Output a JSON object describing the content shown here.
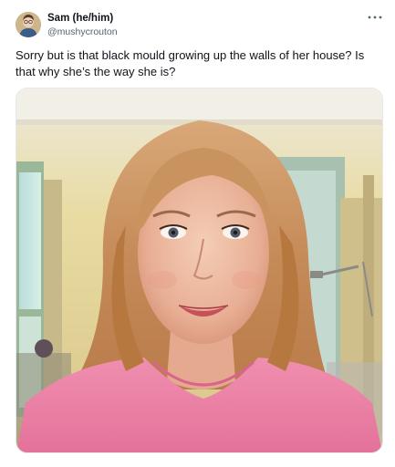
{
  "tweet": {
    "author": {
      "display_name": "Sam (he/him)",
      "handle": "@mushycrouton",
      "avatar_icon": "profile-photo-avatar"
    },
    "more_icon": "more-options-icon",
    "text": "Sorry but is that black mould growing up the walls of her house? Is that why she’s the way she is?",
    "media": {
      "kind": "photo",
      "description_icon": "woman-portrait-photo"
    }
  },
  "colors": {
    "text_primary": "#0f1419",
    "text_secondary": "#536471",
    "border": "#e6e9eb"
  }
}
